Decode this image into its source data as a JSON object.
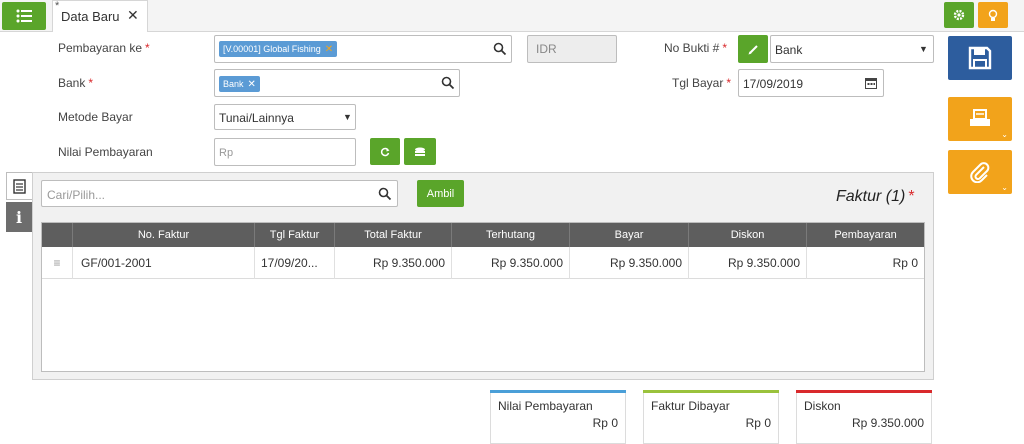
{
  "tab": {
    "modified_marker": "*",
    "label": "Data Baru"
  },
  "form": {
    "pembayaran_ke": {
      "label": "Pembayaran ke",
      "required": "*",
      "chip": "[V.00001] Global Fishing"
    },
    "currency": "IDR",
    "bank": {
      "label": "Bank",
      "required": "*",
      "chip": "Bank"
    },
    "metode_bayar": {
      "label": "Metode Bayar",
      "value": "Tunai/Lainnya"
    },
    "nilai_pembayaran": {
      "label": "Nilai Pembayaran",
      "placeholder": "Rp"
    },
    "no_bukti": {
      "label": "No Bukti #",
      "required": "*",
      "value": "Bank"
    },
    "tgl_bayar": {
      "label": "Tgl Bayar",
      "required": "*",
      "value": "17/09/2019"
    }
  },
  "invoice_panel": {
    "search_placeholder": "Cari/Pilih...",
    "ambil_label": "Ambil",
    "title": "Faktur (1)",
    "required": "*",
    "columns": [
      "",
      "No. Faktur",
      "Tgl Faktur",
      "Total Faktur",
      "Terhutang",
      "Bayar",
      "Diskon",
      "Pembayaran"
    ],
    "rows": [
      {
        "handle": "≡",
        "no_faktur": "GF/001-2001",
        "tgl_faktur": "17/09/20...",
        "total_faktur": "Rp 9.350.000",
        "terhutang": "Rp 9.350.000",
        "bayar": "Rp 9.350.000",
        "diskon": "Rp 9.350.000",
        "pembayaran": "Rp 0"
      }
    ]
  },
  "summary": [
    {
      "title": "Nilai Pembayaran",
      "value": "Rp 0",
      "color": "#4a9fd8"
    },
    {
      "title": "Faktur Dibayar",
      "value": "Rp 0",
      "color": "#9ac23c"
    },
    {
      "title": "Diskon",
      "value": "Rp 9.350.000",
      "color": "#d9292c"
    }
  ],
  "colors": {
    "green": "#5aa52a",
    "orange": "#f2a31b",
    "blue": "#2d5d9e",
    "header": "#5e5e5e"
  },
  "icons": [
    "list-menu-icon",
    "close-icon",
    "gear-icon",
    "bulb-icon",
    "search-icon",
    "pencil-icon",
    "calendar-icon",
    "refresh-icon",
    "stack-icon",
    "save-icon",
    "print-icon",
    "paperclip-icon",
    "document-icon",
    "info-icon",
    "drag-handle-icon"
  ]
}
